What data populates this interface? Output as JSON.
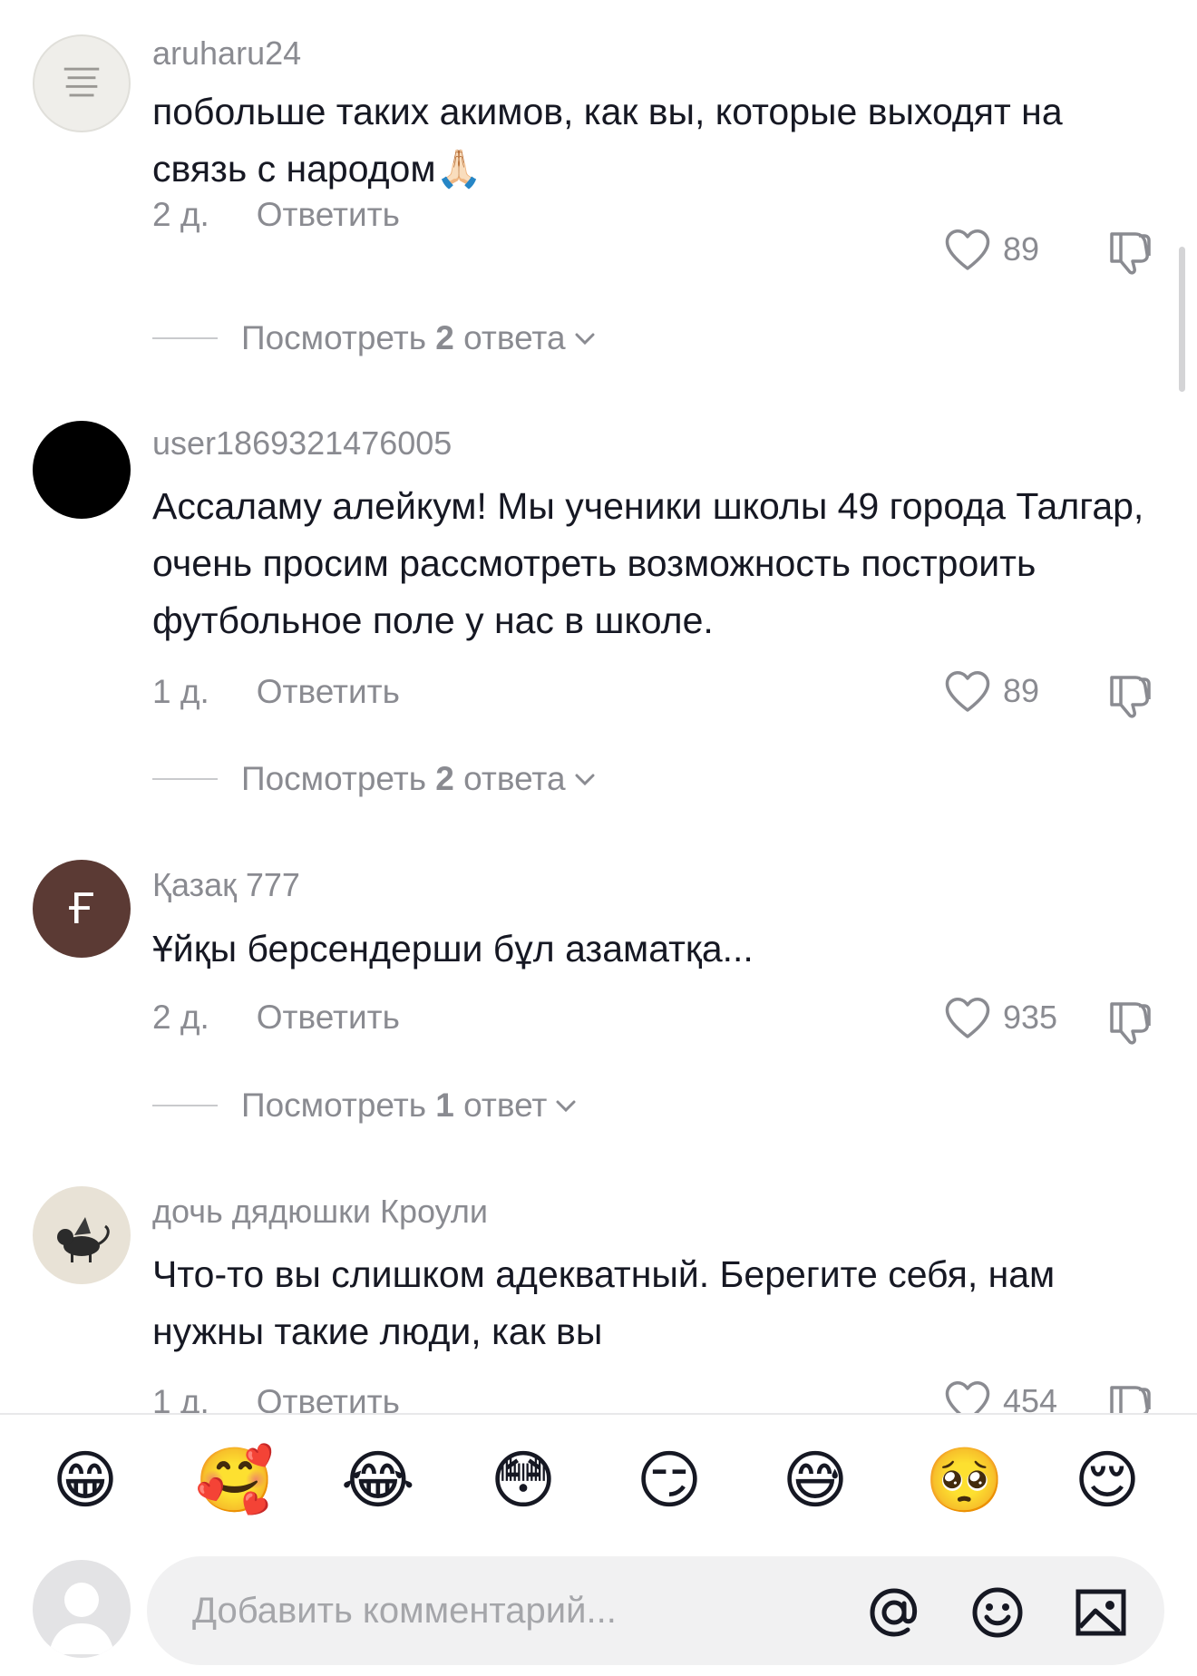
{
  "comments": [
    {
      "username": "aruharu24",
      "text": "побольше таких акимов, как вы, которые выходят на связь с народом🙏🏻",
      "age": "2 д.",
      "reply_label": "Ответить",
      "likes": "89",
      "view_prefix": "Посмотреть",
      "view_count": "2",
      "view_suffix": "ответа"
    },
    {
      "username": "user1869321476005",
      "text": "Ассаламу алейкум! Мы ученики школы 49 города Талгар, очень просим рассмотреть возможность построить футбольное поле у нас в школе.",
      "age": "1 д.",
      "reply_label": "Ответить",
      "likes": "89",
      "view_prefix": "Посмотреть",
      "view_count": "2",
      "view_suffix": "ответа"
    },
    {
      "username": "Қазақ 777",
      "avatar_letter": "Ғ",
      "text": "Ұйқы берсендерши бұл азаматқа...",
      "age": "2 д.",
      "reply_label": "Ответить",
      "likes": "935",
      "view_prefix": "Посмотреть",
      "view_count": "1",
      "view_suffix": "ответ"
    },
    {
      "username": "дочь дядюшки Кроули",
      "text": "Что-то вы слишком адекватный. Берегите себя, нам нужны такие люди, как вы",
      "age": "1 д.",
      "reply_label": "Ответить",
      "likes": "454"
    }
  ],
  "emoji_bar": [
    "😁",
    "🥰",
    "😂",
    "😳",
    "😏",
    "😅",
    "🥺",
    "😌"
  ],
  "composer": {
    "placeholder": "Добавить комментарий...",
    "mention_icon": "at-sign-icon",
    "emoji_icon": "smiley-icon",
    "image_icon": "image-icon"
  },
  "colors": {
    "text": "#161823",
    "muted": "#8a8b91",
    "input_bg": "#f1f1f2",
    "avatar_brown": "#5b3a34"
  }
}
